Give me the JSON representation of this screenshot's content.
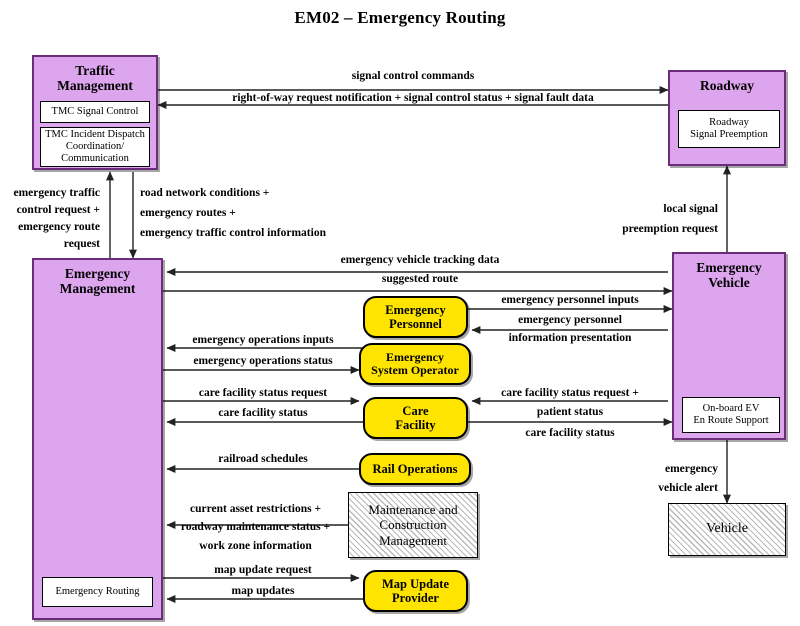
{
  "title": "EM02 – Emergency Routing",
  "colors": {
    "terminator_fill": "#DDA5EE",
    "terminator_border": "#6B2D7A",
    "yellow_fill": "#FFE400",
    "hatch_stroke": "#B9B9B9",
    "line": "#000000"
  },
  "nodes": {
    "traffic_management": {
      "label": "Traffic\nManagement",
      "line1": "Traffic",
      "line2": "Management",
      "subs": [
        "TMC Signal Control",
        "TMC Incident Dispatch Coordination/ Communication"
      ],
      "sub2_l1": "TMC Incident Dispatch",
      "sub2_l2": "Coordination/",
      "sub2_l3": "Communication"
    },
    "roadway": {
      "line1": "Roadway",
      "subs": [
        "Roadway Signal Preemption"
      ],
      "sub1_l1": "Roadway",
      "sub1_l2": "Signal Preemption"
    },
    "emergency_management": {
      "line1": "Emergency",
      "line2": "Management",
      "subs": [
        "Emergency Routing"
      ]
    },
    "emergency_vehicle": {
      "line1": "Emergency",
      "line2": "Vehicle",
      "subs": [
        "On-board EV En Route Support"
      ],
      "sub1_l1": "On-board EV",
      "sub1_l2": "En Route Support"
    },
    "emergency_personnel": {
      "line1": "Emergency",
      "line2": "Personnel"
    },
    "emergency_system_operator": {
      "line1": "Emergency",
      "line2": "System Operator"
    },
    "care_facility": {
      "line1": "Care",
      "line2": "Facility"
    },
    "rail_operations": {
      "line1": "Rail Operations"
    },
    "maintenance": {
      "line1": "Maintenance and",
      "line2": "Construction",
      "line3": "Management"
    },
    "map_update_provider": {
      "line1": "Map Update",
      "line2": "Provider"
    },
    "vehicle": {
      "line1": "Vehicle"
    }
  },
  "flows": {
    "signal_control_commands": "signal control commands",
    "row_status": "right-of-way request notification + signal control status + signal fault data",
    "etc_request_l1": "emergency traffic",
    "etc_request_l2": "control request +",
    "etc_request_l3": "emergency route",
    "etc_request_l4": "request",
    "road_net_l1": "road network conditions +",
    "road_net_l2": "emergency routes +",
    "road_net_l3": "emergency traffic control information",
    "local_preempt_l1": "local signal",
    "local_preempt_l2": "preemption request",
    "ev_tracking": "emergency vehicle tracking data",
    "suggested_route": "suggested route",
    "ep_inputs": "emergency personnel inputs",
    "ep_info_l1": "emergency personnel",
    "ep_info_l2": "information presentation",
    "eops_inputs": "emergency operations inputs",
    "eops_status": "emergency operations status",
    "cf_status_request": "care facility status request",
    "cf_status": "care facility status",
    "cf_req_patient_l1": "care facility status request +",
    "cf_req_patient_l2": "patient status",
    "cf_status_right": "care facility status",
    "railroad_schedules": "railroad schedules",
    "asset_l1": "current asset restrictions +",
    "asset_l2": "roadway maintenance status +",
    "asset_l3": "work zone information",
    "map_update_request": "map update request",
    "map_updates": "map updates",
    "ev_alert_l1": "emergency",
    "ev_alert_l2": "vehicle alert"
  }
}
